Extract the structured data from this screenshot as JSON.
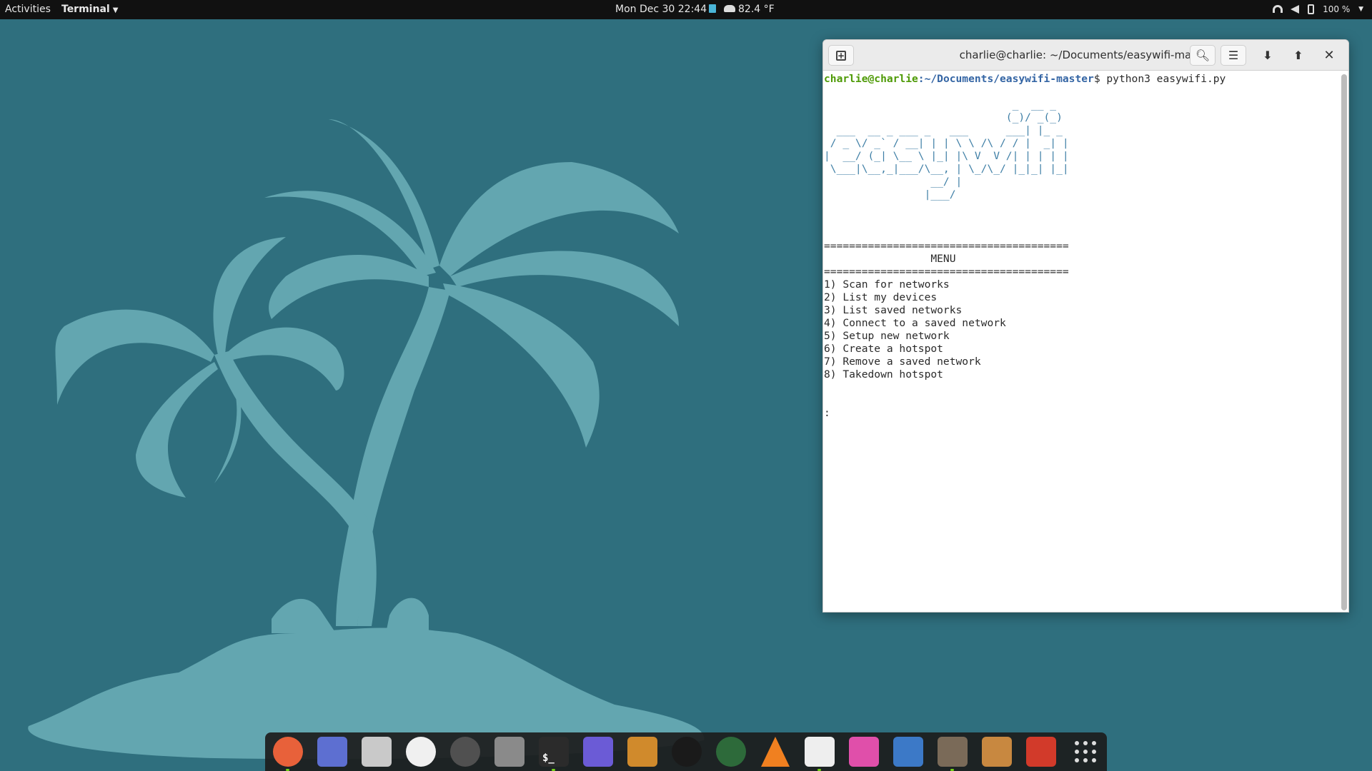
{
  "topbar": {
    "activities": "Activities",
    "app_menu": "Terminal",
    "clock": "Mon Dec 30  22:44",
    "weather": "82.4 °F",
    "battery": "100 %"
  },
  "terminal": {
    "title": "charlie@charlie: ~/Documents/easywifi-master",
    "prompt_user": "charlie@charlie",
    "prompt_path": ":~/Documents/easywifi-master",
    "prompt_symbol": "$",
    "command": " python3 easywifi.py",
    "banner_lines": [
      "                              _  __ _",
      "                             (_)/ _(_)",
      "  ___  __ _ ___ _   ___      ___| |_ _",
      " / _ \\/ _` / __| | | \\ \\ /\\ / / |  _| |",
      "|  __/ (_| \\__ \\ |_| |\\ V  V /| | | | |",
      " \\___|\\__,_|___/\\__, | \\_/\\_/ |_|_| |_|",
      "                 __/ |",
      "                |___/"
    ],
    "separator": "=======================================",
    "menu_title": "                 MENU",
    "menu_items": [
      "1) Scan for networks",
      "2) List my devices",
      "3) List saved networks",
      "4) Connect to a saved network",
      "5) Setup new network",
      "6) Create a hotspot",
      "7) Remove a saved network",
      "8) Takedown hotspot"
    ],
    "input_prompt": ":"
  },
  "dock": {
    "apps": [
      {
        "name": "firefox",
        "color": "#e8613a",
        "running": true
      },
      {
        "name": "files",
        "color": "#5d6fd1",
        "running": false
      },
      {
        "name": "rhythmbox",
        "color": "#c9c9c9",
        "running": false
      },
      {
        "name": "screen-recorder",
        "color": "#f0f0f0",
        "running": false
      },
      {
        "name": "gnome",
        "color": "#505050",
        "running": false
      },
      {
        "name": "settings",
        "color": "#8a8a8a",
        "running": false
      },
      {
        "name": "terminal",
        "color": "#2b2b2b",
        "running": true
      },
      {
        "name": "audio-editor",
        "color": "#6b5bd6",
        "running": false
      },
      {
        "name": "cocktail",
        "color": "#d08a2c",
        "running": false
      },
      {
        "name": "obs-studio",
        "color": "#1a1a1a",
        "running": false
      },
      {
        "name": "camera",
        "color": "#2d6a3a",
        "running": false
      },
      {
        "name": "vlc",
        "color": "#f08020",
        "running": false
      },
      {
        "name": "text-editor",
        "color": "#eeeeee",
        "running": true
      },
      {
        "name": "password-manager",
        "color": "#e04faa",
        "running": false
      },
      {
        "name": "video-editor",
        "color": "#3c79c7",
        "running": false
      },
      {
        "name": "gimp",
        "color": "#7a6a58",
        "running": true
      },
      {
        "name": "paint",
        "color": "#c88840",
        "running": false
      },
      {
        "name": "trash",
        "color": "#d23a2a",
        "running": false
      }
    ]
  }
}
